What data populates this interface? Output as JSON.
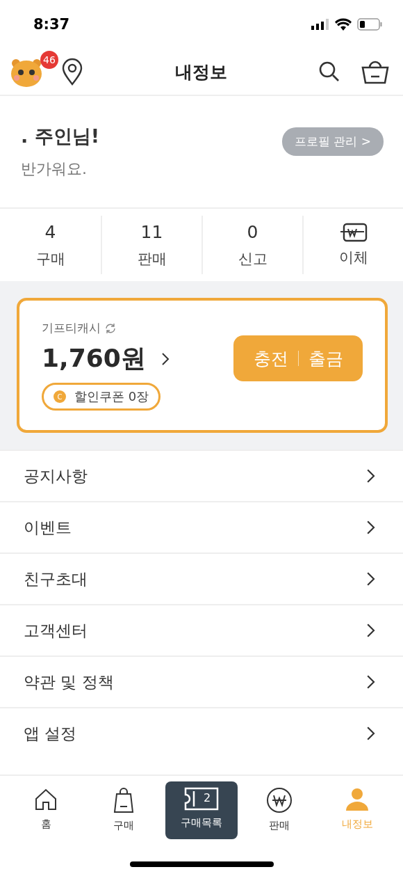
{
  "status_bar": {
    "time": "8:37"
  },
  "header": {
    "title": "내정보",
    "notification_count": "46"
  },
  "profile": {
    "greeting": ". 주인님!",
    "subtitle": "반가워요.",
    "manage_button": "프로필 관리 >"
  },
  "stats": [
    {
      "kind": "count",
      "value": "4",
      "label": "구매"
    },
    {
      "kind": "count",
      "value": "11",
      "label": "판매"
    },
    {
      "kind": "count",
      "value": "0",
      "label": "신고"
    },
    {
      "kind": "icon",
      "label": "이체"
    }
  ],
  "cash_card": {
    "label": "기프티캐시",
    "amount": "1,760원",
    "coupon": "할인쿠폰 0장",
    "coupon_icon": "C",
    "charge": "충전",
    "withdraw": "출금"
  },
  "menu": [
    "공지사항",
    "이벤트",
    "친구초대",
    "고객센터",
    "약관 및 정책",
    "앱 설정"
  ],
  "tab_bar": [
    {
      "kind": "home",
      "label": "홈",
      "selected": false
    },
    {
      "kind": "bag",
      "label": "구매",
      "selected": false
    },
    {
      "kind": "ticket",
      "label": "구매목록",
      "badge": "2",
      "selected": false
    },
    {
      "kind": "won",
      "label": "판매",
      "selected": false
    },
    {
      "kind": "person",
      "label": "내정보",
      "selected": true
    }
  ]
}
